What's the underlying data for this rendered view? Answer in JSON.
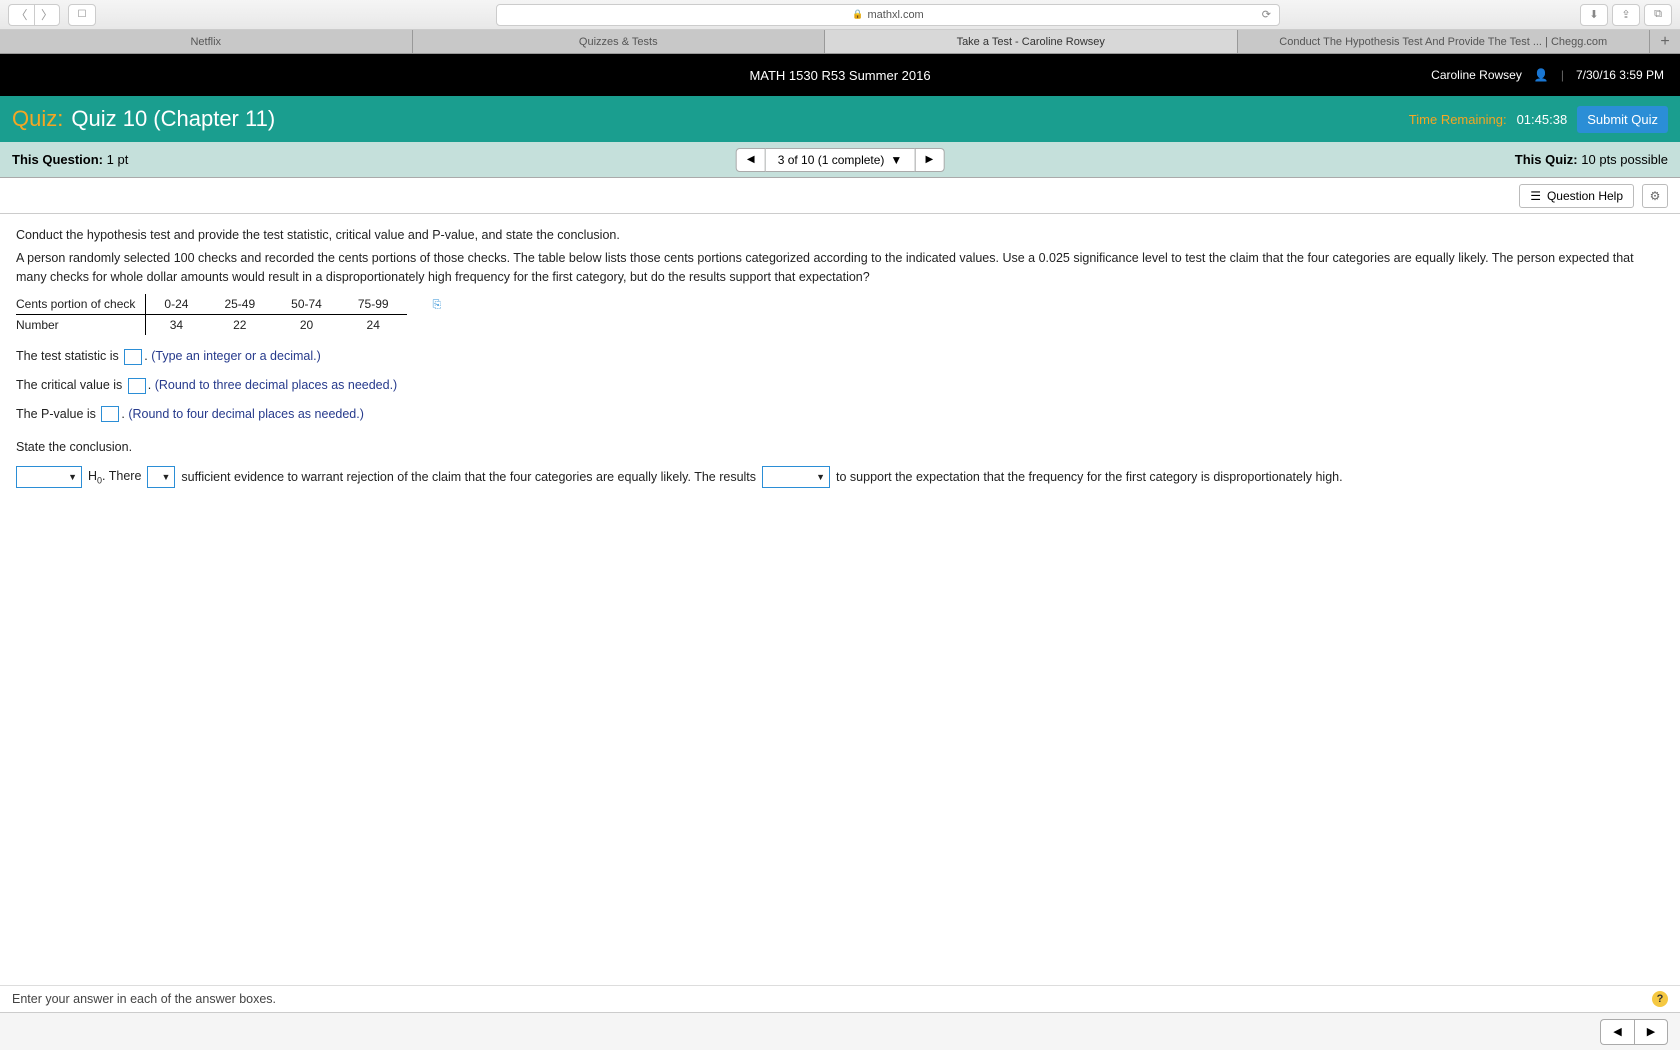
{
  "browser": {
    "url": "mathxl.com",
    "tabs": [
      {
        "label": "Netflix",
        "active": false
      },
      {
        "label": "Quizzes & Tests",
        "active": false
      },
      {
        "label": "Take a Test - Caroline Rowsey",
        "active": true
      },
      {
        "label": "Conduct The Hypothesis Test And Provide The Test ... | Chegg.com",
        "active": false
      }
    ]
  },
  "header": {
    "course": "MATH 1530 R53 Summer 2016",
    "user": "Caroline Rowsey",
    "datetime": "7/30/16 3:59 PM"
  },
  "quiz": {
    "label": "Quiz:",
    "title": "Quiz 10 (Chapter 11)",
    "time_remaining_label": "Time Remaining:",
    "time_remaining": "01:45:38",
    "submit_label": "Submit Quiz"
  },
  "question_bar": {
    "this_question_label": "This Question:",
    "this_question_pts": "1 pt",
    "counter": "3 of 10 (1 complete)",
    "this_quiz_label": "This Quiz:",
    "this_quiz_pts": "10 pts possible"
  },
  "help": {
    "button": "Question Help"
  },
  "question": {
    "intro": "Conduct the hypothesis test and provide the test statistic, critical value and P-value, and state the conclusion.",
    "body": "A person randomly selected 100 checks and recorded the cents portions of those checks. The table below lists those cents portions categorized according to the indicated values. Use a 0.025 significance level to test the claim that the four categories are equally likely. The person expected that many checks for whole dollar amounts would result in a disproportionately high frequency for the first category, but do the results support that expectation?",
    "table": {
      "row_labels": [
        "Cents portion of check",
        "Number"
      ],
      "cols": [
        "0-24",
        "25-49",
        "50-74",
        "75-99"
      ],
      "values": [
        34,
        22,
        20,
        24
      ]
    },
    "line1_a": "The test statistic is ",
    "line1_b": ". ",
    "hint1": "(Type an integer or a decimal.)",
    "line2_a": "The critical value is ",
    "line2_b": ". ",
    "hint2": "(Round to three decimal places as needed.)",
    "line3_a": "The P-value is ",
    "line3_b": ". ",
    "hint3": "(Round to four decimal places as needed.)",
    "conclusion_label": "State the conclusion.",
    "frag_h0": " H",
    "frag_h0_sub": "0",
    "frag_there": ". There ",
    "frag_mid": " sufficient evidence to warrant rejection of the claim that the four categories are equally likely. The results ",
    "frag_end": " to support the expectation that the frequency for the first category is disproportionately high."
  },
  "footer": {
    "hint": "Enter your answer in each of the answer boxes."
  }
}
